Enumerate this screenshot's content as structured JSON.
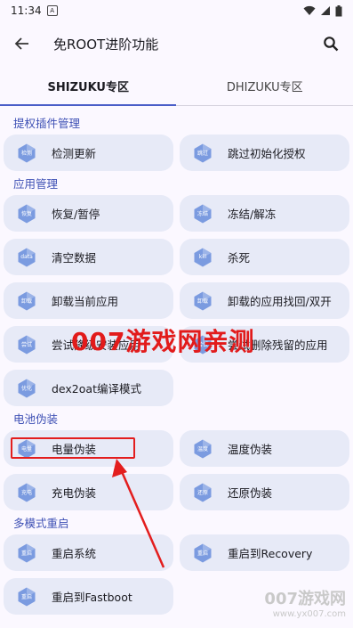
{
  "status": {
    "time": "11:34",
    "badge": "A"
  },
  "appbar": {
    "title": "免ROOT进阶功能"
  },
  "tabs": [
    {
      "label": "SHIZUKU专区",
      "active": true
    },
    {
      "label": "DHIZUKU专区",
      "active": false
    }
  ],
  "sections": {
    "s1": {
      "title": "提权插件管理",
      "items": [
        {
          "icon": "检测",
          "label": "检测更新"
        },
        {
          "icon": "跳过",
          "label": "跳过初始化授权"
        }
      ]
    },
    "s2": {
      "title": "应用管理",
      "items": [
        {
          "icon": "恢复",
          "label": "恢复/暂停"
        },
        {
          "icon": "冻结",
          "label": "冻结/解冻"
        },
        {
          "icon": "data",
          "label": "清空数据"
        },
        {
          "icon": "kill",
          "label": "杀死"
        },
        {
          "icon": "卸载",
          "label": "卸载当前应用"
        },
        {
          "icon": "卸载",
          "label": "卸载的应用找回/双开"
        },
        {
          "icon": "尝试",
          "label": "尝试降级安装应用"
        },
        {
          "icon": "尝试",
          "label": "尝试删除残留的应用"
        },
        {
          "icon": "优化",
          "label": "dex2oat编译模式"
        }
      ]
    },
    "s3": {
      "title": "电池伪装",
      "items": [
        {
          "icon": "电量",
          "label": "电量伪装"
        },
        {
          "icon": "温度",
          "label": "温度伪装"
        },
        {
          "icon": "充电",
          "label": "充电伪装"
        },
        {
          "icon": "还原",
          "label": "还原伪装"
        }
      ]
    },
    "s4": {
      "title": "多模式重启",
      "items": [
        {
          "icon": "重启",
          "label": "重启系统"
        },
        {
          "icon": "重启",
          "label": "重启到Recovery"
        },
        {
          "icon": "重启",
          "label": "重启到Fastboot"
        }
      ]
    }
  },
  "overlay": {
    "watermark": "007游戏网亲测",
    "logo_big": "007游戏网",
    "logo_small": "www.yx007.com"
  },
  "colors": {
    "accent": "#3f51b5",
    "card": "#e7eaf7",
    "icon": "#7b9be0",
    "annotation": "#e31e1e"
  }
}
